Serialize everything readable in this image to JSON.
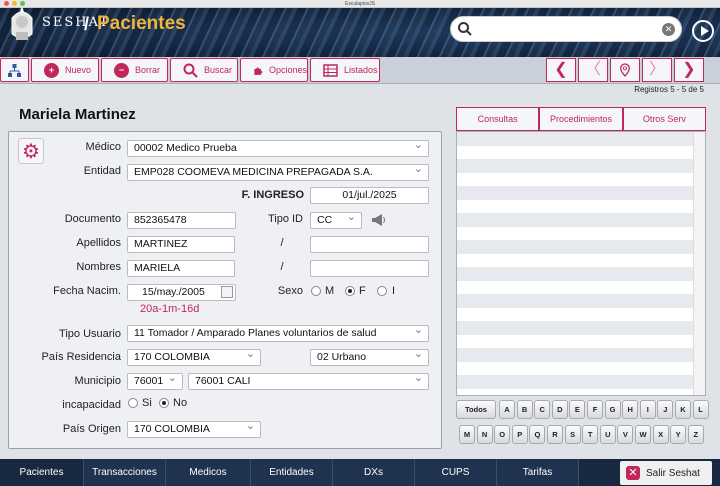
{
  "window_title": "EsculapiosJS",
  "header": {
    "brand": "SESHAT",
    "separator": "/",
    "title": "Pacientes",
    "search_placeholder": ""
  },
  "toolbar": {
    "nuevo": "Nuevo",
    "borrar": "Borrar",
    "buscar": "Buscar",
    "opciones": "Opciones",
    "listados": "Listados"
  },
  "registros": "Registros 5 - 5 de 5",
  "patient_name": "Mariela  Martinez",
  "form": {
    "medico_label": "Médico",
    "medico": "00002 Medico Prueba",
    "entidad_label": "Entidad",
    "entidad": "EMP028 COOMEVA MEDICINA PREPAGADA S.A.",
    "ingreso_label": "F. INGRESO",
    "ingreso": "01/jul./2025",
    "documento_label": "Documento",
    "documento": "852365478",
    "tipoid_label": "Tipo ID",
    "tipoid": "CC",
    "apellidos_label": "Apellidos",
    "apellido1": "MARTINEZ",
    "apellido2": "",
    "nombres_label": "Nombres",
    "nombre1": "MARIELA",
    "nombre2": "",
    "slash": "/",
    "fnac_label": "Fecha Nacim.",
    "fnac": "15/may./2005",
    "edad": "20a-1m-16d",
    "sexo_label": "Sexo",
    "sexo_m": "M",
    "sexo_f": "F",
    "sexo_i": "I",
    "tipousuario_label": "Tipo Usuario",
    "tipousuario": "11 Tomador / Amparado Planes  voluntarios de salud",
    "pais_res_label": "País Residencia",
    "pais_res": "170 COLOMBIA",
    "zona": "02 Urbano",
    "municipio_label": "Municipio",
    "municipio_cod": "76001",
    "municipio": "76001 CALI",
    "incapacidad_label": "incapacidad",
    "si": "Si",
    "no": "No",
    "pais_origen_label": "País Origen",
    "pais_origen": "170 COLOMBIA"
  },
  "tabs": [
    "Consultas",
    "Procedimientos",
    "Otros Serv"
  ],
  "keyboard": {
    "todos": "Todos",
    "row1": [
      "A",
      "B",
      "C",
      "D",
      "E",
      "F",
      "G",
      "H",
      "I",
      "J",
      "K",
      "L"
    ],
    "row2": [
      "M",
      "N",
      "O",
      "P",
      "Q",
      "R",
      "S",
      "T",
      "U",
      "V",
      "W",
      "X",
      "Y",
      "Z"
    ]
  },
  "bottom_nav": [
    "Pacientes",
    "Transacciones",
    "Medicos",
    "Entidades",
    "DXs",
    "CUPS",
    "Tarifas"
  ],
  "salir": "Salir Seshat",
  "colors": {
    "accent": "#c0285a",
    "brand": "#f2b33a",
    "nav": "#1f3250"
  }
}
